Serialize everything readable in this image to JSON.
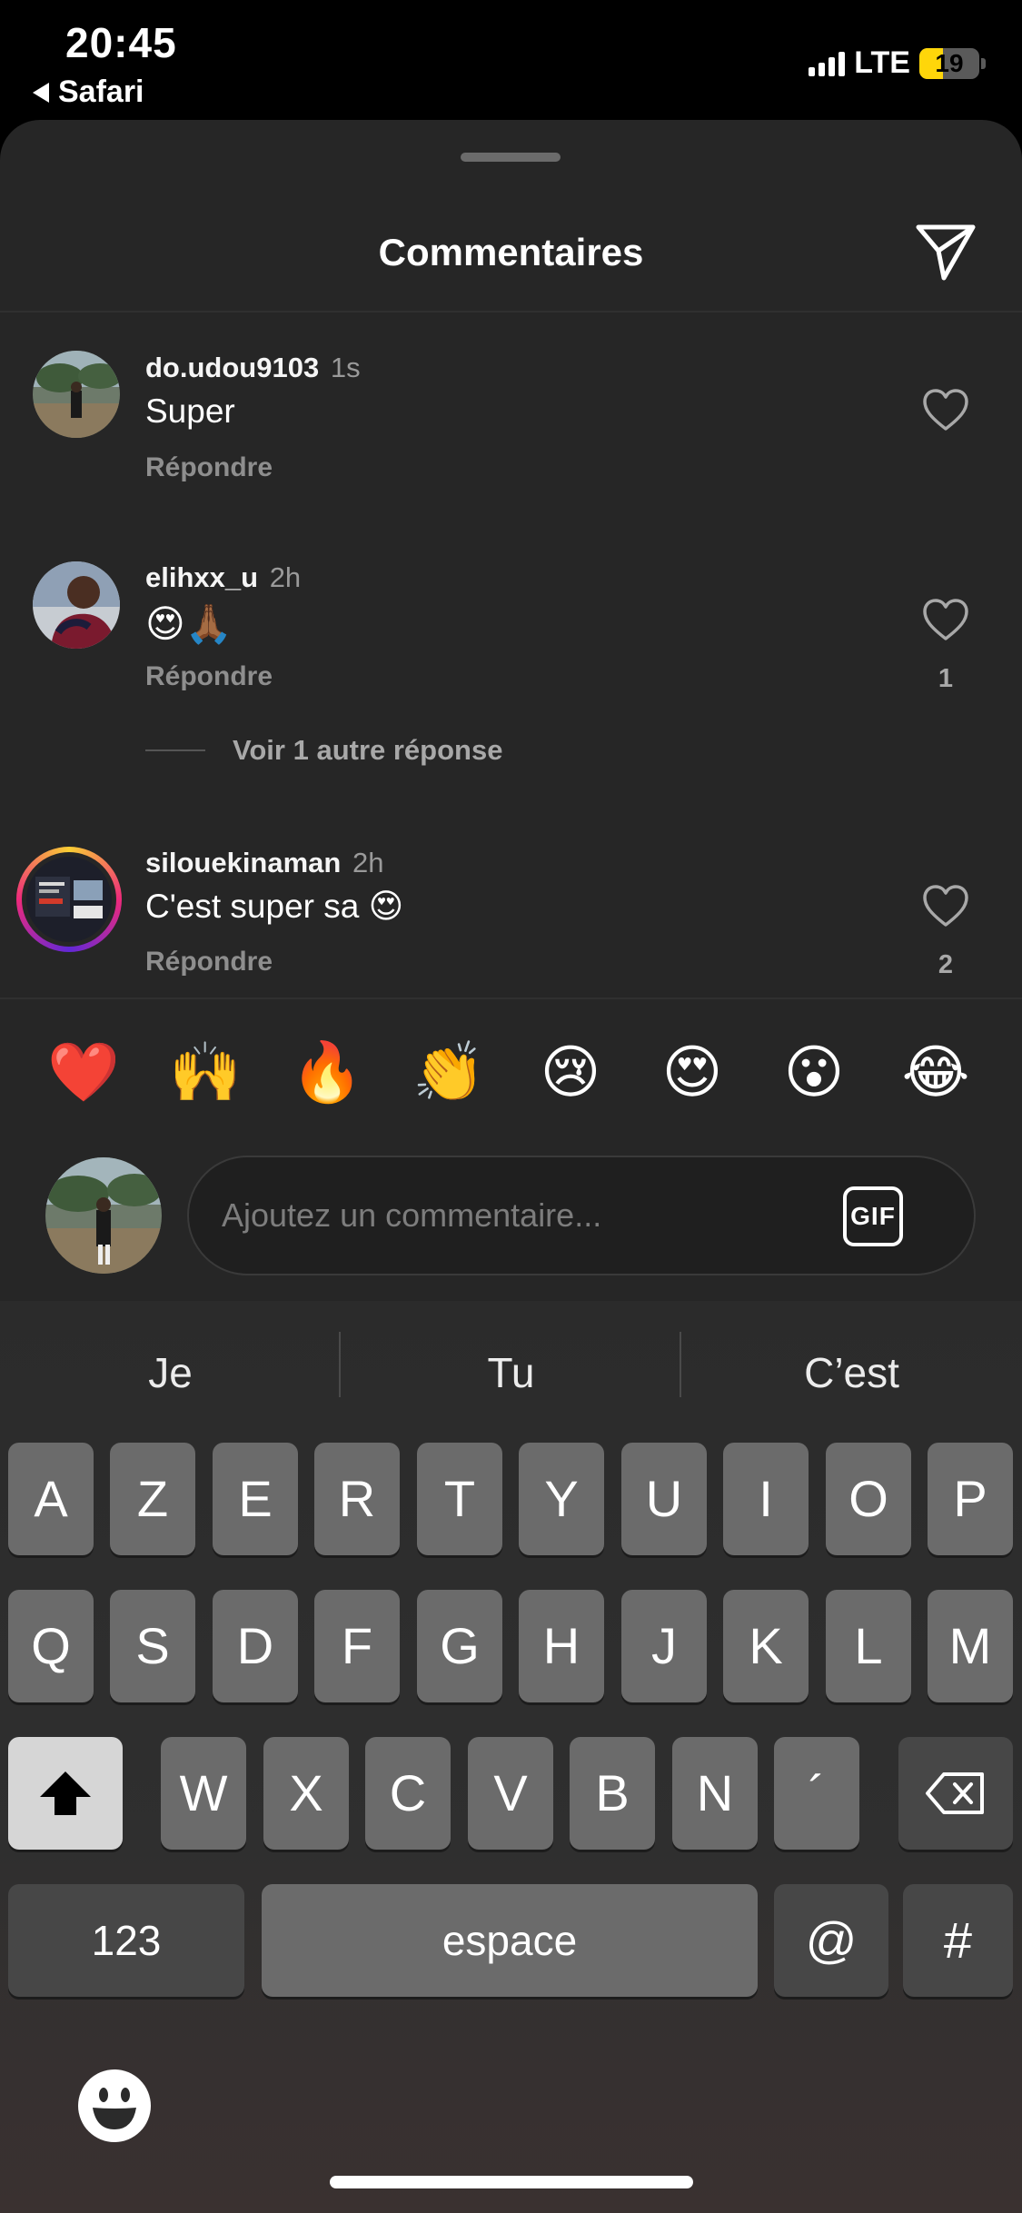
{
  "status_bar": {
    "time": "20:45",
    "back_app": "Safari",
    "network": "LTE",
    "battery_level": "19",
    "battery_color": "#ffd60a"
  },
  "sheet": {
    "title": "Commentaires",
    "send_icon": "paper-plane-icon"
  },
  "comments": [
    {
      "username": "do.udou9103",
      "time": "1s",
      "text": "Super",
      "reply": "Répondre",
      "likes": ""
    },
    {
      "username": "elihxx_u",
      "time": "2h",
      "text": "😍🙏🏾",
      "reply": "Répondre",
      "likes": "1"
    },
    {
      "username": "silouekinaman",
      "time": "2h",
      "text": "C'est super sa 😍",
      "reply": "Répondre",
      "likes": "2"
    }
  ],
  "more_replies": "Voir 1 autre réponse",
  "reaction_emojis": [
    "❤️",
    "🙌",
    "🔥",
    "👏",
    "😢",
    "😍",
    "😮",
    "😂"
  ],
  "composer": {
    "placeholder": "Ajoutez un commentaire...",
    "gif_label": "GIF"
  },
  "keyboard": {
    "suggestions": [
      "Je",
      "Tu",
      "C’est"
    ],
    "row1": [
      "A",
      "Z",
      "E",
      "R",
      "T",
      "Y",
      "U",
      "I",
      "O",
      "P"
    ],
    "row2": [
      "Q",
      "S",
      "D",
      "F",
      "G",
      "H",
      "J",
      "K",
      "L",
      "M"
    ],
    "row3": [
      "W",
      "X",
      "C",
      "V",
      "B",
      "N",
      "´"
    ],
    "numbers_key": "123",
    "space_key": "espace",
    "at_key": "@",
    "hash_key": "#"
  }
}
